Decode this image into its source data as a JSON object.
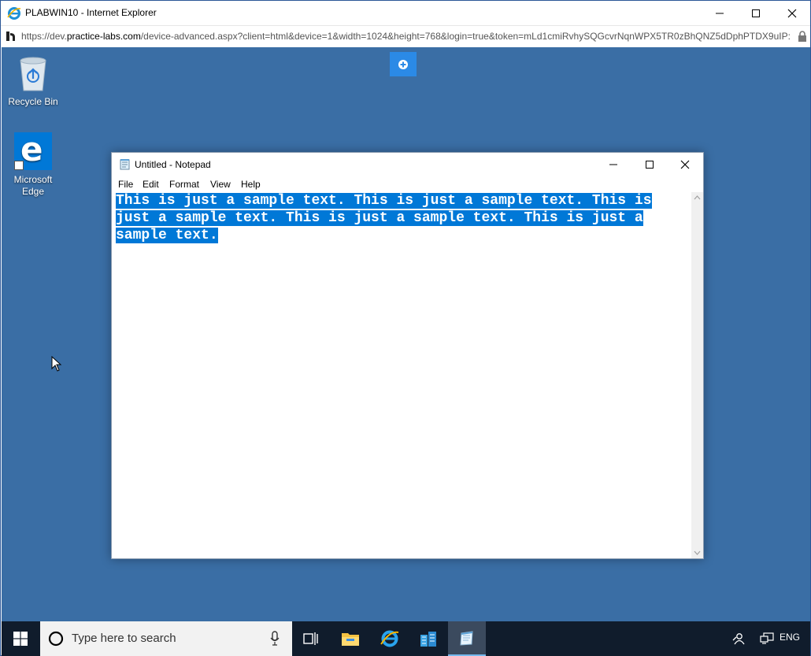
{
  "browser": {
    "title": "PLABWIN10 - Internet Explorer",
    "url_prefix": "https://dev.",
    "url_domain": "practice-labs.com",
    "url_rest": "/device-advanced.aspx?client=html&device=1&width=1024&height=768&login=true&token=mLd1cmiRvhySQGcvrNqnWPX5TR0zBhQNZ5dDphPTDX9uIP:"
  },
  "desktop": {
    "icons": [
      {
        "label": "Recycle Bin"
      },
      {
        "label": "Microsoft",
        "label2": "Edge"
      }
    ]
  },
  "notepad": {
    "title": "Untitled - Notepad",
    "menu": [
      "File",
      "Edit",
      "Format",
      "View",
      "Help"
    ],
    "lines": [
      "This is just a sample text. This is just a sample text. This is",
      "just a sample text. This is just a sample text. This is just a",
      "sample text."
    ]
  },
  "taskbar": {
    "search_placeholder": "Type here to search",
    "language": "ENG"
  },
  "colors": {
    "desktop": "#3a6ea5",
    "selection": "#0078d7",
    "taskbar": "#101c2c"
  }
}
